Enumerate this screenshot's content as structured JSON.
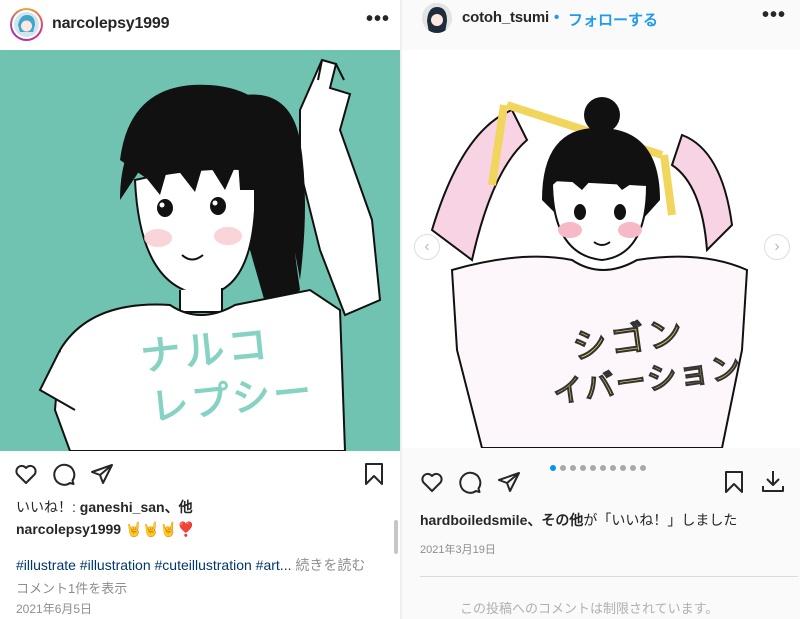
{
  "left_post": {
    "username": "narcolepsy1999",
    "more_label": "•••",
    "likes_prefix": "いいね！:",
    "likes_user": "ganeshi_san",
    "likes_suffix": "、他",
    "caption_user": "narcolepsy1999",
    "caption_emoji": "🤘🤘🤘❣️",
    "hashtags": "#illustrate #illustration #cuteillustration #art...",
    "read_more": "続きを読む",
    "comments_link": "コメント1件を表示",
    "date": "2021年6月5日",
    "shirt_text_line1": "ナルコ",
    "shirt_text_line2": "レプシー"
  },
  "right_post": {
    "username": "cotoh_tsumi",
    "separator": "•",
    "follow_label": "フォローする",
    "more_label": "•••",
    "liked_user": "hardboiledsmile",
    "liked_suffix_bold": "、その他",
    "liked_mid": "が「",
    "liked_word": "いいね！",
    "liked_end": "」しました",
    "date": "2021年3月19日",
    "comments_restricted": "この投稿へのコメントは制限されています。",
    "carousel_total": 10,
    "carousel_active": 1,
    "shirt_text_line1": "シゴン",
    "shirt_text_line2": "イバーション"
  },
  "colors": {
    "left_bg": "#6fc3b0",
    "teal_text": "#86d3c3",
    "yellow": "#f2d55c",
    "link_blue": "#0095f6"
  },
  "icons": [
    "heart-icon",
    "comment-icon",
    "share-icon",
    "bookmark-icon",
    "download-icon",
    "chevron-left-icon",
    "chevron-right-icon",
    "more-icon"
  ]
}
